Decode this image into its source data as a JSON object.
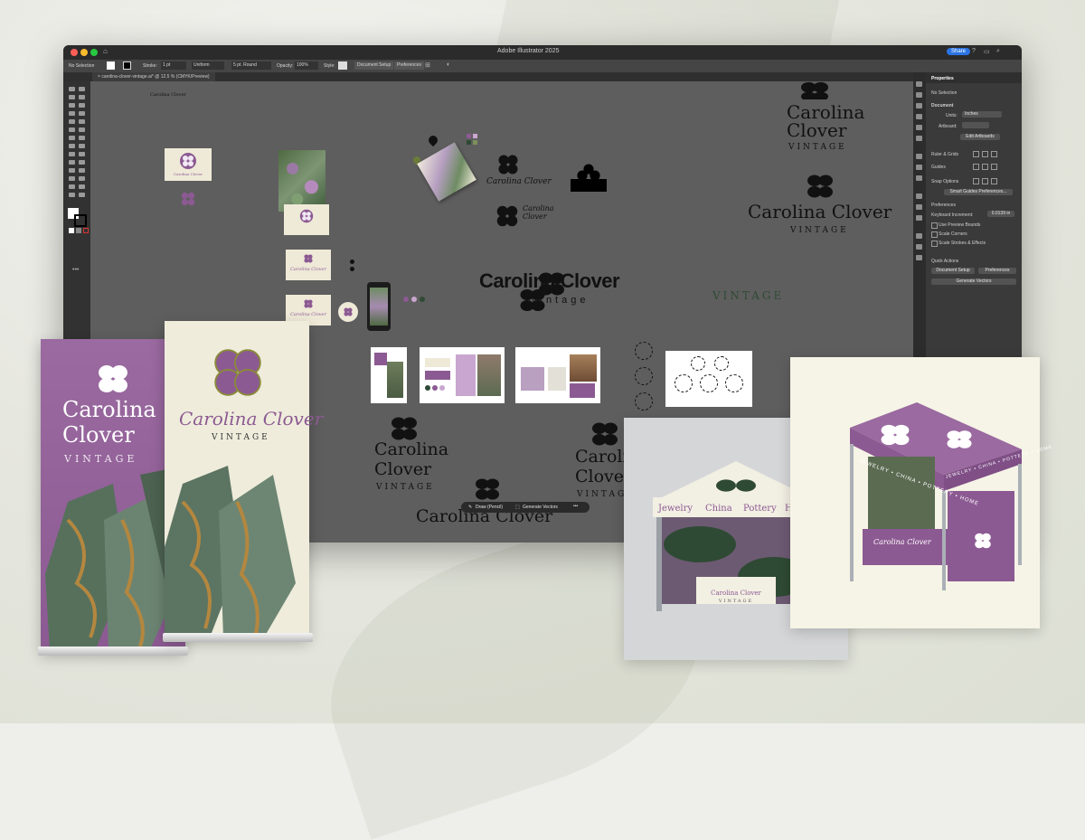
{
  "app": {
    "window_title": "Adobe Illustrator 2025",
    "share_label": "Share",
    "document_tab": "carolina-clover-vintage.ai* @ 12.5 % (CMYK/Preview)"
  },
  "control_bar": {
    "selection": "No Selection",
    "stroke_label": "Stroke:",
    "stroke_value": "1 pt",
    "uniform": "Uniform",
    "brush": "5 pt. Round",
    "opacity_label": "Opacity:",
    "opacity_value": "100%",
    "style_label": "Style:",
    "document_setup": "Document Setup",
    "preferences": "Preferences"
  },
  "properties_panel": {
    "tab": "Properties",
    "no_selection": "No Selection",
    "document": "Document",
    "units_label": "Units:",
    "units_value": "Inches",
    "artboard_label": "Artboard:",
    "edit_artboards": "Edit Artboards",
    "ruler_grids": "Ruler & Grids",
    "guides": "Guides",
    "snap_options": "Snap Options",
    "smart_guides_prefs": "Smart Guides Preferences...",
    "preferences_section": "Preferences",
    "keyboard_increment_label": "Keyboard Increment:",
    "keyboard_increment_value": "0.0139 in",
    "use_preview_bounds": "Use Preview Bounds",
    "scale_corners": "Scale Corners",
    "scale_strokes": "Scale Strokes & Effects",
    "quick_actions": "Quick Actions",
    "document_setup_btn": "Document Setup",
    "preferences_btn": "Preferences",
    "generate_vectors_btn": "Generate Vectors"
  },
  "contextual_bar": {
    "draw_label": "Draw (Pencil)",
    "generate_label": "Generate Vectors"
  },
  "brand": {
    "name_line1": "Carolina",
    "name_line2": "Clover",
    "name_full": "Carolina Clover",
    "vintage_upper": "VINTAGE",
    "vintage_lower": "vintage",
    "tent_words": [
      "Jewelry",
      "China",
      "Pottery",
      "Home"
    ],
    "tent_side_text": "JEWELRY • CHINA • POTTERY • HOME"
  },
  "colors": {
    "purple": "#8c5a92",
    "dark_green": "#2f4a34",
    "cream": "#efe9d8",
    "canvas_gray": "#5e5e5e"
  }
}
